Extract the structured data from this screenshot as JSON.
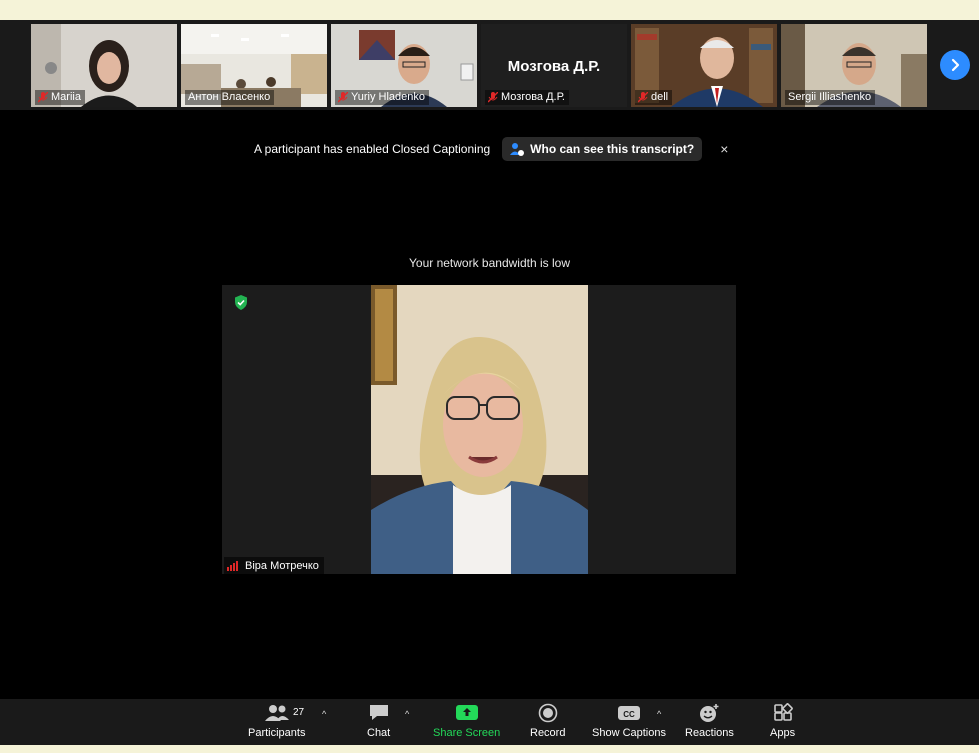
{
  "gallery": {
    "tiles": [
      {
        "name": "Mariia",
        "muted": true
      },
      {
        "name": "Антон Власенко",
        "muted": false
      },
      {
        "name": "Yuriy Hladenko",
        "muted": true
      },
      {
        "name": "Мозгова Д.Р.",
        "muted": true,
        "display_name": "Мозгова Д.Р."
      },
      {
        "name": "dell",
        "muted": true
      },
      {
        "name": "Sergii Illiashenko",
        "muted": false
      }
    ]
  },
  "caption": {
    "message": "A participant has enabled Closed Captioning",
    "transcript_button": "Who can see this transcript?",
    "close": "×"
  },
  "bandwidth_notice": "Your network bandwidth is low",
  "main_video": {
    "speaker_name": "Віра Мотречко"
  },
  "toolbar": {
    "participants_label": "Participants",
    "participants_count": "27",
    "chat_label": "Chat",
    "share_label": "Share Screen",
    "record_label": "Record",
    "captions_label": "Show Captions",
    "reactions_label": "Reactions",
    "apps_label": "Apps",
    "caret": "^"
  },
  "colors": {
    "accent_blue": "#2d8cff",
    "share_green": "#23d959",
    "mute_red": "#e02828",
    "shield_green": "#23b352"
  }
}
